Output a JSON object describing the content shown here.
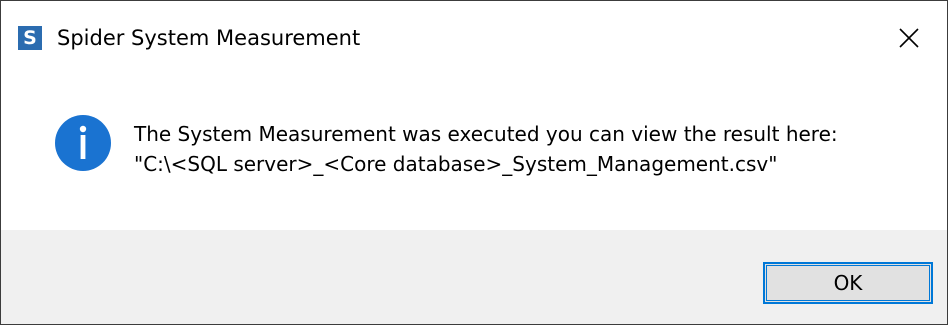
{
  "window": {
    "title": "Spider System Measurement",
    "app_icon_letter": "S",
    "app_icon_name": "spider-app-icon",
    "close_icon_name": "close-icon"
  },
  "message": {
    "icon_name": "info-icon",
    "line1": "The System Measurement was executed you can view the result here:",
    "line2": "\"C:\\<SQL server>_<Core database>_System_Management.csv\""
  },
  "buttons": {
    "ok_label": "OK"
  },
  "colors": {
    "app_icon_bg": "#2b6cb0",
    "info_icon_bg": "#1a73d1",
    "footer_bg": "#f0f0f0",
    "button_focus_border": "#0078d7"
  }
}
